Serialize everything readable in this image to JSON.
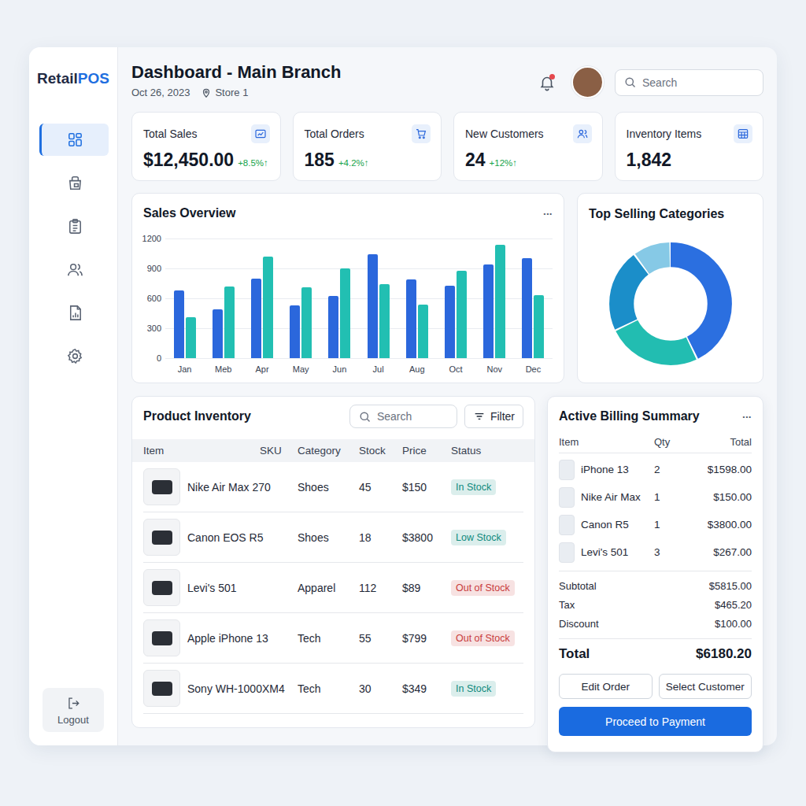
{
  "sidebar": {
    "logo": {
      "primary": "Retail",
      "accent": "POS"
    },
    "items": [
      {
        "selected": true
      },
      {
        "selected": false
      },
      {
        "selected": false
      },
      {
        "selected": false
      },
      {
        "selected": false
      },
      {
        "selected": false
      }
    ],
    "logout": "Logout"
  },
  "header": {
    "title": "Dashboard - Main Branch",
    "date": "Oct 26, 2023",
    "location": "Store 1",
    "has_notification": true,
    "search_placeholder": "Search"
  },
  "stats": [
    {
      "label": "Total Sales",
      "value": "$12,450.00",
      "change": "+8.5%↑"
    },
    {
      "label": "Total Orders",
      "value": "185",
      "change": "+4.2%↑"
    },
    {
      "label": "New Customers",
      "value": "24",
      "change": "+12%↑"
    },
    {
      "label": "Inventory Items",
      "value": "1,842"
    }
  ],
  "sales_chart": {
    "title": "Sales Overview",
    "menu": "•••",
    "y_ticks": [
      "1200",
      "900",
      "600",
      "300",
      "0"
    ],
    "months": [
      "Jan",
      "Meb",
      "Apr",
      "May",
      "Jun",
      "Jul",
      "Aug",
      "Oct",
      "Nov",
      "Dec"
    ],
    "series": [
      {
        "values": [
          680,
          490,
          800,
          530,
          620,
          1040,
          790,
          730,
          940,
          1000
        ],
        "color": "#2b67dc"
      },
      {
        "values": [
          410,
          720,
          1020,
          710,
          900,
          740,
          540,
          880,
          1140,
          630
        ],
        "color": "#22bfb2"
      }
    ]
  },
  "categories_chart": {
    "title": "Top Selling Categories",
    "segments": [
      {
        "value": 43,
        "color": "#2b6fe0"
      },
      {
        "value": 25,
        "color": "#22bdb1"
      },
      {
        "value": 22,
        "color": "#1b8ec9"
      },
      {
        "value": 10,
        "color": "#86c9e6"
      }
    ]
  },
  "inventory": {
    "title": "Product Inventory",
    "search_placeholder": "Search",
    "filter_label": "Filter",
    "columns": [
      "Item",
      "SKU",
      "Category",
      "Stock",
      "Price",
      "Status"
    ],
    "rows": [
      {
        "item": "Nike Air Max 270",
        "category": "Shoes",
        "stock": "45",
        "price": "$150",
        "status": "In Stock",
        "color": "#0f8a7e"
      },
      {
        "item": "Canon EOS R5",
        "category": "Shoes",
        "stock": "18",
        "price": "$3800",
        "status": "Low Stock",
        "color": "#0f8a7e"
      },
      {
        "item": "Levi's 501",
        "category": "Apparel",
        "stock": "112",
        "price": "$89",
        "status": "Out of Stock",
        "color": "#c93c3c"
      },
      {
        "item": "Apple iPhone 13",
        "category": "Tech",
        "stock": "55",
        "price": "$799",
        "status": "Out of Stock",
        "color": "#c93c3c"
      },
      {
        "item": "Sony WH-1000XM4",
        "category": "Tech",
        "stock": "30",
        "price": "$349",
        "status": "In Stock",
        "color": "#0f8a7e"
      }
    ]
  },
  "billing": {
    "title": "Active Billing Summary",
    "menu": "•••",
    "columns": [
      "Item",
      "Qty",
      "Total"
    ],
    "items": [
      {
        "item": "iPhone 13",
        "qty": "2",
        "total": "$1598.00"
      },
      {
        "item": "Nike Air Max",
        "qty": "1",
        "total": "$150.00"
      },
      {
        "item": "Canon R5",
        "qty": "1",
        "total": "$3800.00"
      },
      {
        "item": "Levi's 501",
        "qty": "3",
        "total": "$267.00"
      }
    ],
    "summary": [
      {
        "label": "Subtotal",
        "value": "$5815.00"
      },
      {
        "label": "Tax",
        "value": "$465.20"
      },
      {
        "label": "Discount",
        "value": "$100.00"
      }
    ],
    "total": {
      "label": "Total",
      "value": "$6180.20"
    },
    "buttons": [
      "Edit Order",
      "Select Customer"
    ],
    "primary_button": "Proceed to Payment"
  }
}
